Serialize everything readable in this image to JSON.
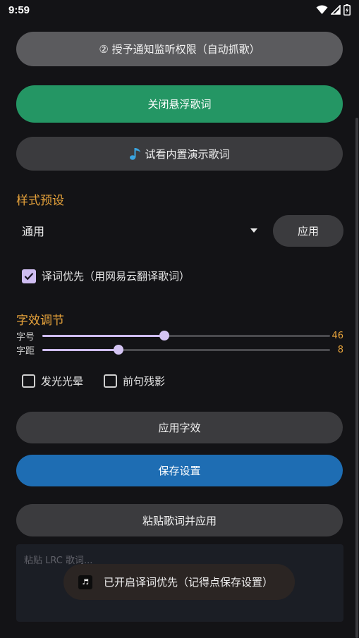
{
  "status_bar": {
    "time": "9:59"
  },
  "buttons": {
    "permission": "② 授予通知监听权限（自动抓歌）",
    "toggle_floating": "关闭悬浮歌词",
    "demo_label": "试看内置演示歌词",
    "apply_preset": "应用",
    "apply_effects": "应用字效",
    "save_settings": "保存设置",
    "paste_apply": "粘贴歌词并应用"
  },
  "preset": {
    "title": "样式预设",
    "selected": "通用"
  },
  "translation_pref": {
    "label": "译词优先（用网易云翻译歌词）",
    "checked": true
  },
  "effects": {
    "title": "字效调节",
    "font_size": {
      "label": "字号",
      "value": "46",
      "fraction": 0.424
    },
    "spacing": {
      "label": "字距",
      "value": "8",
      "fraction": 0.265
    },
    "glow": {
      "label": "发光光晕",
      "checked": false
    },
    "trail": {
      "label": "前句残影",
      "checked": false
    }
  },
  "lrc_input": {
    "placeholder": "粘贴 LRC 歌词..."
  },
  "toast": {
    "message": "已开启译词优先（记得点保存设置）"
  },
  "colors": {
    "background": "#131316",
    "accent_orange": "#e7a33b",
    "green_button": "#249664",
    "blue_button": "#1e6db3",
    "checkbox_purple": "#cfbdf2"
  },
  "icons": [
    "wifi-icon",
    "signal-icon",
    "battery-icon",
    "music-note-icon",
    "dropdown-arrow-icon",
    "check-icon",
    "app-icon"
  ]
}
